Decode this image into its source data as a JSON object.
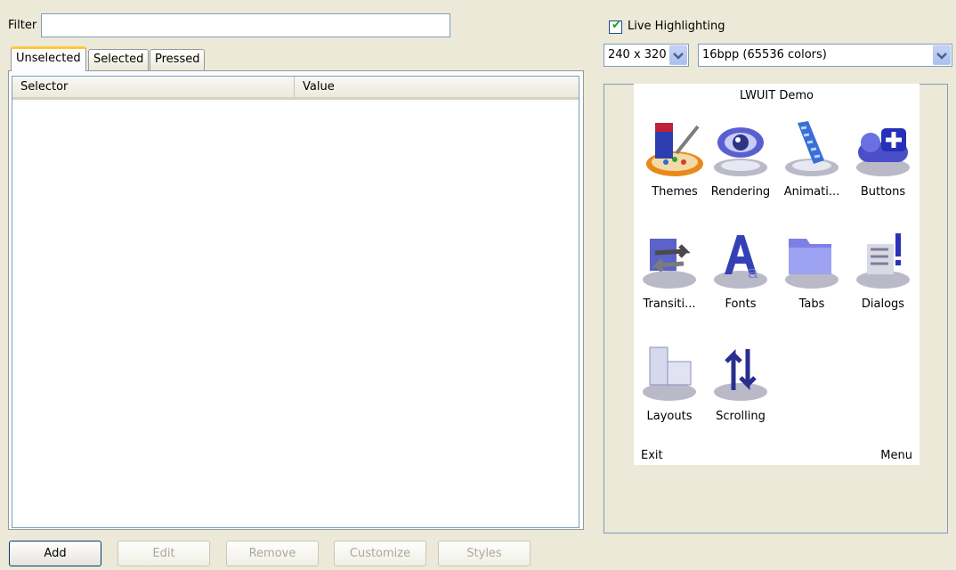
{
  "filter": {
    "label": "Filter",
    "value": ""
  },
  "tabs": [
    {
      "label": "Unselected",
      "active": true
    },
    {
      "label": "Selected",
      "active": false
    },
    {
      "label": "Pressed",
      "active": false
    }
  ],
  "table": {
    "columns": [
      "Selector",
      "Value"
    ],
    "rows": []
  },
  "buttons": {
    "add": "Add",
    "edit": "Edit",
    "remove": "Remove",
    "customize": "Customize",
    "styles": "Styles"
  },
  "live_highlighting": {
    "label": "Live Highlighting",
    "checked": true
  },
  "resolution": {
    "selected": "240 x 320"
  },
  "color_depth": {
    "selected": "16bpp (65536 colors)"
  },
  "preview": {
    "title": "LWUIT Demo",
    "apps": [
      {
        "label": "Themes",
        "icon": "themes-icon"
      },
      {
        "label": "Rendering",
        "icon": "rendering-icon"
      },
      {
        "label": "Animati...",
        "icon": "animations-icon"
      },
      {
        "label": "Buttons",
        "icon": "buttons-icon"
      },
      {
        "label": "Transiti...",
        "icon": "transitions-icon"
      },
      {
        "label": "Fonts",
        "icon": "fonts-icon"
      },
      {
        "label": "Tabs",
        "icon": "tabs-icon"
      },
      {
        "label": "Dialogs",
        "icon": "dialogs-icon"
      },
      {
        "label": "Layouts",
        "icon": "layouts-icon"
      },
      {
        "label": "Scrolling",
        "icon": "scrolling-icon"
      }
    ],
    "softkey_left": "Exit",
    "softkey_right": "Menu"
  }
}
